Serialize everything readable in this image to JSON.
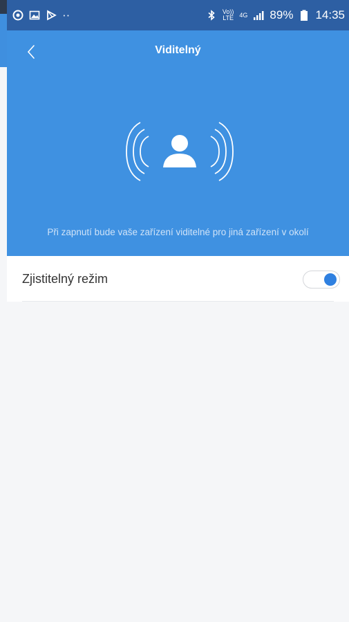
{
  "status_bar": {
    "battery": "89%",
    "time": "14:35",
    "volte_top": "Vo))",
    "volte_bottom": "LTE",
    "network": "4G"
  },
  "header": {
    "title": "Viditelný"
  },
  "hero": {
    "hint": "Při zapnutí bude vaše zařízení viditelné pro jiná zařízení v okolí"
  },
  "settings": {
    "discoverable_label": "Zjistitelný režim",
    "discoverable_on": true
  },
  "colors": {
    "hero_bg": "#3f91e1",
    "status_bar_bg": "#2d5fa3",
    "toggle_on": "#2f80e0"
  }
}
